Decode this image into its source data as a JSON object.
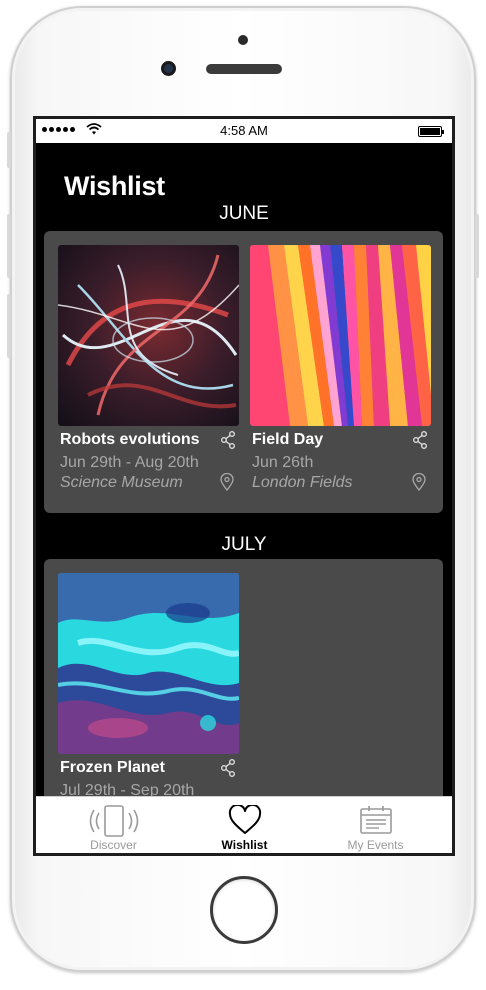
{
  "status_bar": {
    "time": "4:58 AM"
  },
  "page": {
    "title": "Wishlist"
  },
  "sections": [
    {
      "title": "JUNE",
      "events": [
        {
          "title": "Robots evolutions",
          "dates": "Jun 29th - Aug 20th",
          "venue": "Science Museum"
        },
        {
          "title": "Field Day",
          "dates": "Jun 26th",
          "venue": "London Fields"
        }
      ]
    },
    {
      "title": "JULY",
      "events": [
        {
          "title": "Frozen Planet",
          "dates": "Jul 29th - Sep 20th",
          "venue": ""
        }
      ]
    }
  ],
  "tab_bar": {
    "tabs": [
      {
        "label": "Discover",
        "icon": "phone-vibrate-icon",
        "active": false
      },
      {
        "label": "Wishlist",
        "icon": "heart-icon",
        "active": true
      },
      {
        "label": "My Events",
        "icon": "calendar-icon",
        "active": false
      }
    ]
  },
  "colors": {
    "screen_background": "#000000",
    "panel_background": "#4a4a4a",
    "secondary_text": "#a7a7a7",
    "tab_bar_background": "#ffffff"
  }
}
